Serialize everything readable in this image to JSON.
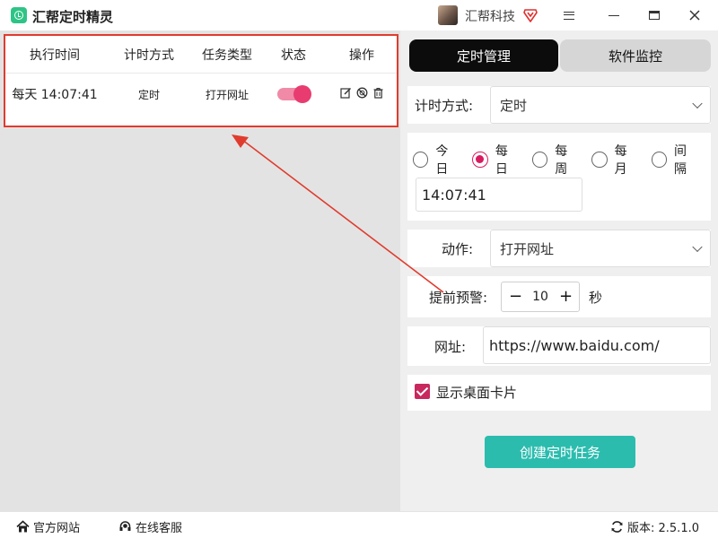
{
  "titlebar": {
    "app_title": "汇帮定时精灵",
    "user_name": "汇帮科技"
  },
  "task_table": {
    "headers": [
      "执行时间",
      "计时方式",
      "任务类型",
      "状态",
      "操作"
    ],
    "rows": [
      {
        "exec_time": "每天 14:07:41",
        "timing_mode": "定时",
        "task_type": "打开网址",
        "status_on": true
      }
    ]
  },
  "tabs": {
    "active": "定时管理",
    "inactive": "软件监控"
  },
  "form": {
    "timing_label": "计时方式:",
    "timing_value": "定时",
    "frequency_options": [
      {
        "label": "今日",
        "checked": false
      },
      {
        "label": "每日",
        "checked": true
      },
      {
        "label": "每周",
        "checked": false
      },
      {
        "label": "每月",
        "checked": false
      },
      {
        "label": "间隔",
        "checked": false
      }
    ],
    "time_value": "14:07:41",
    "action_label": "动作:",
    "action_value": "打开网址",
    "warn_label": "提前预警:",
    "warn_value": "10",
    "warn_minus": "−",
    "warn_plus": "+",
    "warn_unit": "秒",
    "url_label": "网址:",
    "url_value": "https://www.baidu.com/",
    "show_card_label": "显示桌面卡片",
    "show_card_checked": true,
    "create_button": "创建定时任务"
  },
  "statusbar": {
    "website": "官方网站",
    "support": "在线客服",
    "version": "版本: 2.5.1.0"
  },
  "colors": {
    "highlight_border": "#e03c2e",
    "toggle_on": "#e83c70",
    "radio_checked": "#d81b60",
    "create_button": "#2bbcae",
    "active_tab": "#0c0c0c"
  }
}
